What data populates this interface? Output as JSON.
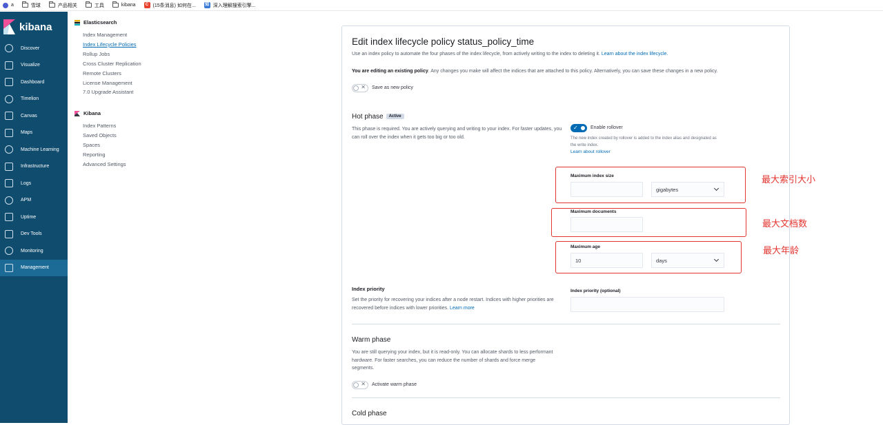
{
  "bookmarks": [
    {
      "label": "a",
      "icon": "app-icon"
    },
    {
      "label": "雪球",
      "icon": "folder-icon"
    },
    {
      "label": "产品相关",
      "icon": "folder-icon"
    },
    {
      "label": "工具",
      "icon": "folder-icon"
    },
    {
      "label": "kibana",
      "icon": "folder-icon"
    },
    {
      "label": "(15条消息) 如何在...",
      "icon": "csdn-icon"
    },
    {
      "label": "深入理解搜索引擎...",
      "icon": "site-icon"
    }
  ],
  "nav": {
    "brand": "kibana",
    "items": [
      {
        "label": "Discover",
        "icon": "compass-icon"
      },
      {
        "label": "Visualize",
        "icon": "chart-icon"
      },
      {
        "label": "Dashboard",
        "icon": "dashboard-icon"
      },
      {
        "label": "Timelion",
        "icon": "shield-icon"
      },
      {
        "label": "Canvas",
        "icon": "canvas-icon"
      },
      {
        "label": "Maps",
        "icon": "globe-icon"
      },
      {
        "label": "Machine Learning",
        "icon": "ml-icon"
      },
      {
        "label": "Infrastructure",
        "icon": "infra-icon"
      },
      {
        "label": "Logs",
        "icon": "logs-icon"
      },
      {
        "label": "APM",
        "icon": "apm-icon"
      },
      {
        "label": "Uptime",
        "icon": "uptime-icon"
      },
      {
        "label": "Dev Tools",
        "icon": "wrench-icon"
      },
      {
        "label": "Monitoring",
        "icon": "heart-icon"
      },
      {
        "label": "Management",
        "icon": "gear-icon"
      }
    ],
    "active": "Management"
  },
  "sidebar": {
    "elasticsearch": {
      "title": "Elasticsearch",
      "links": [
        "Index Management",
        "Index Lifecycle Policies",
        "Rollup Jobs",
        "Cross Cluster Replication",
        "Remote Clusters",
        "License Management",
        "7.0 Upgrade Assistant"
      ]
    },
    "kibana": {
      "title": "Kibana",
      "links": [
        "Index Patterns",
        "Saved Objects",
        "Spaces",
        "Reporting",
        "Advanced Settings"
      ]
    },
    "selected": "Index Lifecycle Policies"
  },
  "page": {
    "title": "Edit index lifecycle policy status_policy_time",
    "intro": "Use an index policy to automate the four phases of the index lifecycle, from actively writing to the index to deleting it.",
    "intro_link": "Learn about the index lifecycle.",
    "editing_bold": "You are editing an existing policy",
    "editing_rest": ". Any changes you make will affect the indices that are attached to this policy. Alternatively, you can save these changes in a new policy.",
    "save_as_new": "Save as new policy",
    "save_as_new_on": false
  },
  "hot": {
    "title": "Hot phase",
    "badge": "Active",
    "desc": "This phase is required. You are actively querying and writing to your index. For faster updates, you can roll over the index when it gets too big or too old.",
    "rollover_label": "Enable rollover",
    "rollover_on": true,
    "rollover_help": "The new index created by rollover is added to the index alias and designated as the write index.",
    "rollover_link": "Learn about rollover",
    "max_size_label": "Maximum index size",
    "max_size_value": "",
    "max_size_unit": "gigabytes",
    "max_docs_label": "Maximum documents",
    "max_docs_value": "",
    "max_age_label": "Maximum age",
    "max_age_value": "10",
    "max_age_unit": "days"
  },
  "priority": {
    "title": "Index priority",
    "desc": "Set the priority for recovering your indices after a node restart. Indices with higher priorities are recovered before indices with lower priorities.",
    "link": "Learn more",
    "field_label": "Index priority (optional)",
    "value": ""
  },
  "warm": {
    "title": "Warm phase",
    "desc": "You are still querying your index, but it is read-only. You can allocate shards to less performant hardware. For faster searches, you can reduce the number of shards and force merge segments.",
    "toggle_label": "Activate warm phase",
    "on": false
  },
  "cold": {
    "title": "Cold phase"
  },
  "annotations": {
    "max_size": "最大索引大小",
    "max_docs": "最大文档数",
    "max_age": "最大年龄",
    "color": "#e3342f"
  }
}
